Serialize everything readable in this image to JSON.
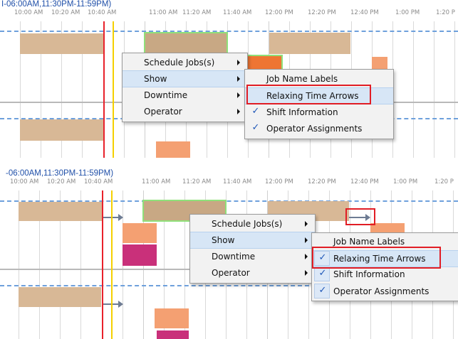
{
  "top": {
    "band_title": "I-06:00AM,11:30PM-11:59PM)",
    "tick_labels": [
      "10:00 AM",
      "10:20 AM",
      "10:40 AM",
      "11:00 AM",
      "11:20 AM",
      "11:40 AM",
      "12:00 PM",
      "12:20 PM",
      "12:40 PM",
      "1:00 PM",
      "1:20 P"
    ],
    "context_menu": {
      "items": [
        {
          "label": "Schedule Jobs(s)",
          "has_submenu": true
        },
        {
          "label": "Show",
          "has_submenu": true,
          "highlighted": true
        },
        {
          "label": "Downtime",
          "has_submenu": true
        },
        {
          "label": "Operator",
          "has_submenu": true
        }
      ]
    },
    "submenu": {
      "items": [
        {
          "label": "Job Name Labels",
          "checked": false
        },
        {
          "label": "Relaxing Time Arrows",
          "checked": false,
          "highlighted": true,
          "annotated": true
        },
        {
          "label": "Shift Information",
          "checked": true
        },
        {
          "label": "Operator Assignments",
          "checked": true
        }
      ]
    }
  },
  "bottom": {
    "band_title": "-06:00AM,11:30PM-11:59PM)",
    "tick_labels": [
      "10:00 AM",
      "10:20 AM",
      "10:40 AM",
      "11:00 AM",
      "11:20 AM",
      "11:40 AM",
      "12:00 PM",
      "12:20 PM",
      "12:40 PM",
      "1:00 PM",
      "1:20 P"
    ],
    "context_menu": {
      "items": [
        {
          "label": "Schedule Jobs(s)",
          "has_submenu": true
        },
        {
          "label": "Show",
          "has_submenu": true,
          "highlighted": true
        },
        {
          "label": "Downtime",
          "has_submenu": true
        },
        {
          "label": "Operator",
          "has_submenu": true
        }
      ]
    },
    "submenu": {
      "items": [
        {
          "label": "Job Name Labels",
          "checked": false
        },
        {
          "label": "Relaxing Time Arrows",
          "checked": true,
          "highlighted": true,
          "annotated": true
        },
        {
          "label": "Shift Information",
          "checked": true
        },
        {
          "label": "Operator Assignments",
          "checked": true
        }
      ]
    }
  },
  "icons": {
    "checkmark": "check-icon",
    "submenu": "chevron-right-icon",
    "arrow": "relaxing-time-arrow-icon"
  },
  "colors": {
    "accent_highlight": "#d7e6f6",
    "annotation_red": "#e11d25",
    "current_time": "#e8212b",
    "marker_yellow": "#f5d000",
    "job_tan": "#d8b896",
    "job_orange": "#f4a072",
    "job_magenta": "#c9307a",
    "shift_dash": "#6ea0dc",
    "title_blue": "#1f4fa8"
  }
}
